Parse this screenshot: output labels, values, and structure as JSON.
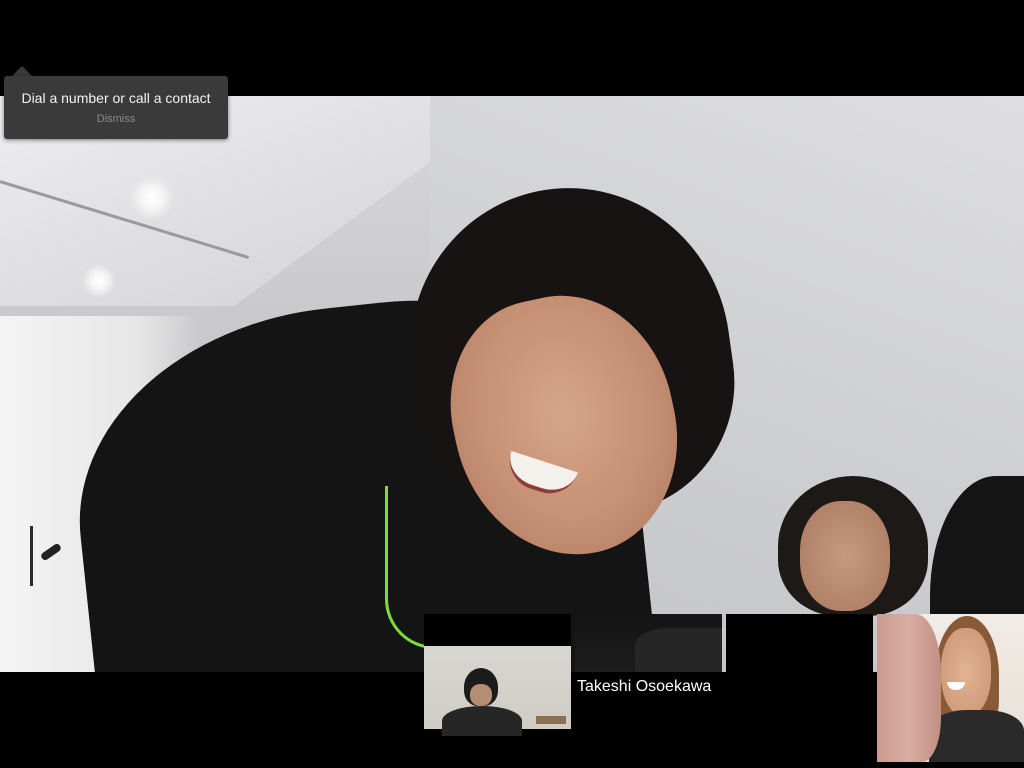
{
  "hint": {
    "text": "Dial a number or call a contact",
    "dismiss_label": "Dismiss"
  },
  "participants": [
    {
      "name": ""
    },
    {
      "name": "Takeshi Osoekawa"
    },
    {
      "name": ""
    },
    {
      "name": ""
    }
  ],
  "colors": {
    "background": "#000000",
    "hint_background": "#3a3a3a",
    "hint_text": "#f2f2f2",
    "hint_dismiss": "#8a8a8a",
    "participant_name": "#ffffff"
  }
}
